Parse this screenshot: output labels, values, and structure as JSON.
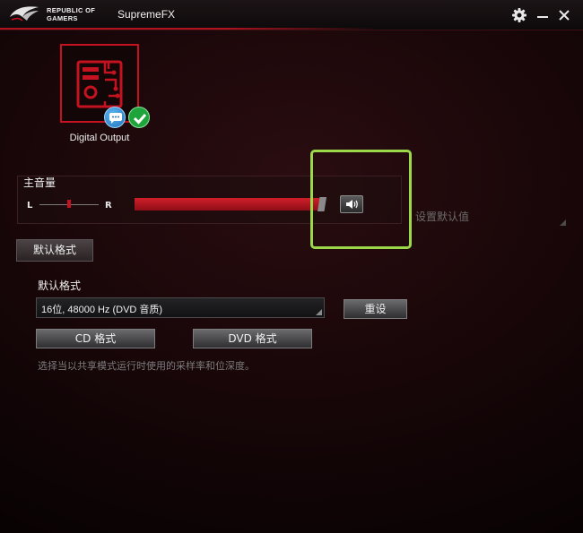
{
  "window": {
    "brand_line1": "REPUBLIC OF",
    "brand_line2": "GAMERS",
    "app_title": "SupremeFX",
    "controls": [
      "settings-icon",
      "minimize-icon",
      "close-icon"
    ]
  },
  "device": {
    "label": "Digital Output",
    "icon": "motherboard-icon",
    "badges": [
      "chat-icon",
      "check-icon"
    ]
  },
  "master_volume": {
    "title": "主音量",
    "balance_left": "L",
    "balance_right": "R",
    "balance_level": 0.5,
    "volume_level": 0.98,
    "mute_icon": "speaker-icon",
    "set_default_label": "设置默认值"
  },
  "tabs": [
    {
      "label": "默认格式",
      "active": true
    }
  ],
  "format": {
    "heading": "默认格式",
    "selected": "16位, 48000 Hz (DVD 音质)",
    "reset_label": "重设",
    "cd_label": "CD 格式",
    "dvd_label": "DVD 格式",
    "hint": "选择当以共享模式运行时使用的采样率和位深度。"
  },
  "colors": {
    "accent_red": "#c41220",
    "highlight_green": "#9bd84a",
    "status_green": "#1fa43c",
    "info_blue": "#1f73b8"
  }
}
